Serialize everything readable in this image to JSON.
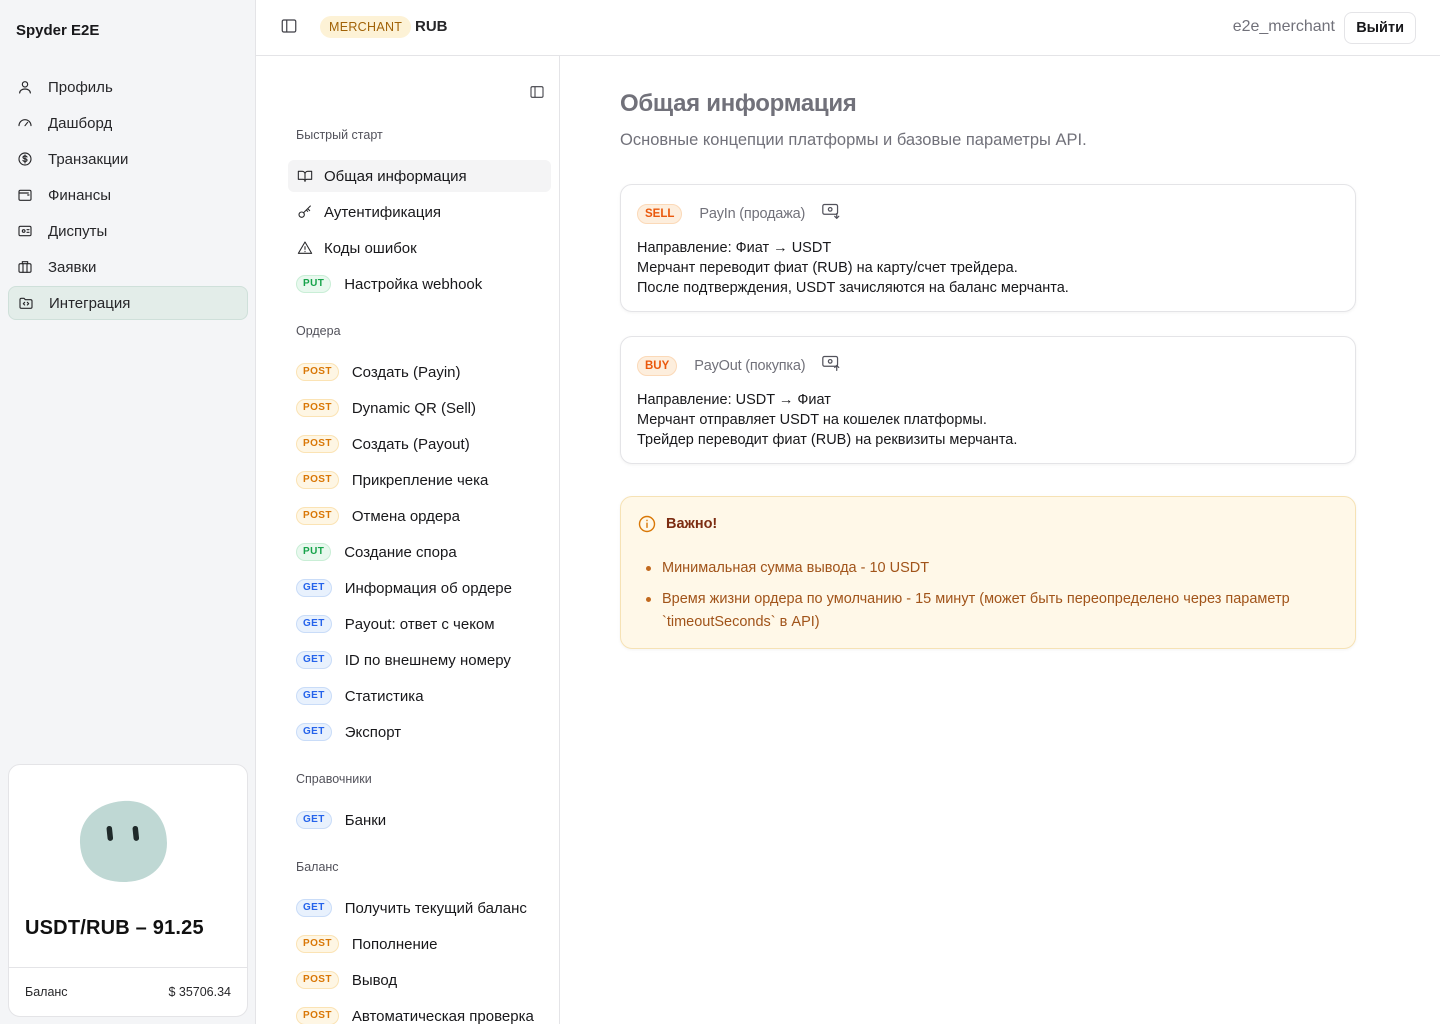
{
  "app": {
    "brand": "Spyder E2E"
  },
  "sidebar": {
    "items": [
      {
        "label": "Профиль",
        "icon": "user-icon"
      },
      {
        "label": "Дашборд",
        "icon": "gauge-icon"
      },
      {
        "label": "Транзакции",
        "icon": "dollar-circle-icon"
      },
      {
        "label": "Финансы",
        "icon": "wallet-icon"
      },
      {
        "label": "Диспуты",
        "icon": "ticket-icon"
      },
      {
        "label": "Заявки",
        "icon": "briefcase-icon"
      },
      {
        "label": "Интеграция",
        "icon": "code-folder-icon"
      }
    ],
    "active": "Интеграция"
  },
  "rate_card": {
    "rate": "USDT/RUB – 91.25",
    "balance_label": "Баланс",
    "balance_value": "$ 35706.34"
  },
  "topbar": {
    "role": "MERCHANT",
    "currency": "RUB",
    "username": "e2e_merchant",
    "logout": "Выйти"
  },
  "docs_nav": {
    "quick_start": {
      "title": "Быстрый старт",
      "items": [
        {
          "label": "Общая информация",
          "icon": "book-icon"
        },
        {
          "label": "Аутентификация",
          "icon": "key-icon"
        },
        {
          "label": "Коды ошибок",
          "icon": "warning-icon"
        },
        {
          "label": "Настройка webhook",
          "method": "PUT"
        }
      ]
    },
    "orders": {
      "title": "Ордера",
      "items": [
        {
          "label": "Создать (Payin)",
          "method": "POST"
        },
        {
          "label": "Dynamic QR (Sell)",
          "method": "POST"
        },
        {
          "label": "Создать (Payout)",
          "method": "POST"
        },
        {
          "label": "Прикрепление чека",
          "method": "POST"
        },
        {
          "label": "Отмена ордера",
          "method": "POST"
        },
        {
          "label": "Создание спора",
          "method": "PUT"
        },
        {
          "label": "Информация об ордере",
          "method": "GET"
        },
        {
          "label": "Payout: ответ с чеком",
          "method": "GET"
        },
        {
          "label": "ID по внешнему номеру",
          "method": "GET"
        },
        {
          "label": "Статистика",
          "method": "GET"
        },
        {
          "label": "Экспорт",
          "method": "GET"
        }
      ]
    },
    "refs": {
      "title": "Справочники",
      "items": [
        {
          "label": "Банки",
          "method": "GET"
        }
      ]
    },
    "balance": {
      "title": "Баланс",
      "items": [
        {
          "label": "Получить текущий баланс",
          "method": "GET"
        },
        {
          "label": "Пополнение",
          "method": "POST"
        },
        {
          "label": "Вывод",
          "method": "POST"
        },
        {
          "label": "Автоматическая проверка",
          "method": "POST"
        }
      ]
    }
  },
  "main": {
    "title": "Общая информация",
    "subtitle": "Основные концепции платформы и базовые параметры API.",
    "cards": [
      {
        "badge": "SELL",
        "name": "PayIn (продажа)",
        "icon": "money-in-icon",
        "lines": [
          "Направление: Фиат → USDT",
          "Мерчант переводит фиат (RUB) на карту/счет трейдера.",
          "После подтверждения, USDT зачисляются на баланс мерчанта."
        ]
      },
      {
        "badge": "BUY",
        "name": "PayOut (покупка)",
        "icon": "money-out-icon",
        "lines": [
          "Направление: USDT → Фиат",
          "Мерчант отправляет USDT на кошелек платформы.",
          "Трейдер переводит фиат (RUB) на реквизиты мерчанта."
        ]
      }
    ],
    "notice": {
      "title": "Важно!",
      "items": [
        "Минимальная сумма вывода - 10 USDT",
        "Время жизни ордера по умолчанию - 15 минут (может быть переопределено через параметр `timeoutSeconds` в API)"
      ]
    }
  },
  "colors": {
    "active_nav_bg": "#e3ede9",
    "post": "#d97706",
    "put": "#16a34a",
    "get": "#2563eb",
    "notice_bg": "#fff8e8"
  }
}
